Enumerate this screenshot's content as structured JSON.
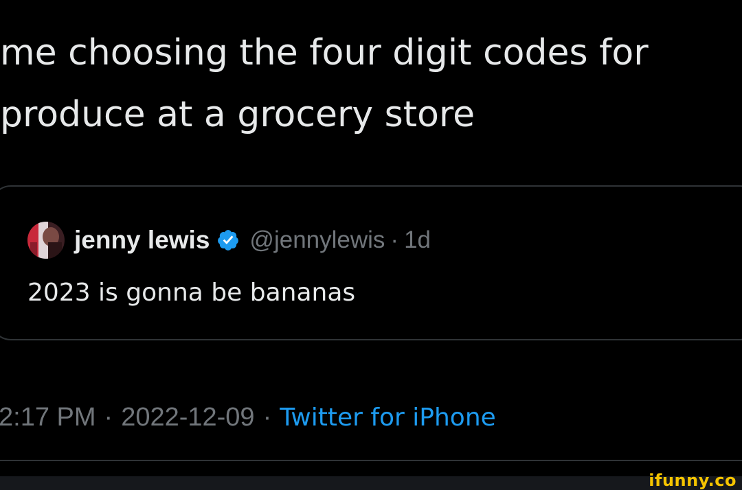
{
  "tweet": {
    "text_line1": "me choosing the four digit codes for",
    "text_line2": "produce at a grocery store"
  },
  "quoted_tweet": {
    "display_name": "jenny lewis",
    "verified": true,
    "verified_icon": "verified-badge-icon",
    "handle": "@jennylewis",
    "separator": "·",
    "age": "1d",
    "text": "2023 is gonna be bananas"
  },
  "meta": {
    "time": "2:17 PM",
    "separator": "·",
    "date": "2022-12-09",
    "source": "Twitter for iPhone"
  },
  "watermark": {
    "text": "ifunny.co"
  },
  "colors": {
    "background": "#000000",
    "text_primary": "#e7e9ea",
    "text_secondary": "#71767b",
    "link_blue": "#1d9bf0",
    "border": "#2f3336",
    "watermark": "#f5c400"
  }
}
